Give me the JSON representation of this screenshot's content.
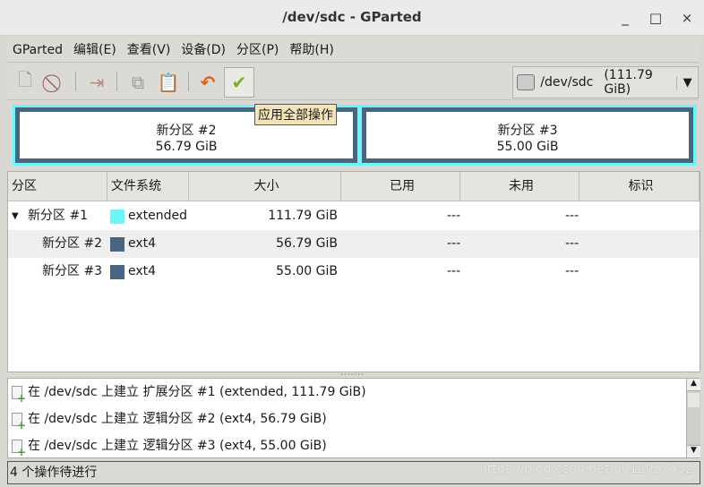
{
  "window": {
    "title": "/dev/sdc - GParted",
    "minimize": "_",
    "maximize": "□",
    "close": "×"
  },
  "menu": [
    "GParted",
    "编辑(E)",
    "查看(V)",
    "设备(D)",
    "分区(P)",
    "帮助(H)"
  ],
  "toolbar": {
    "tooltip": "应用全部操作"
  },
  "device": {
    "name": "/dev/sdc",
    "size": "(111.79 GiB)"
  },
  "graph": [
    {
      "name": "新分区 #2",
      "size": "56.79 GiB"
    },
    {
      "name": "新分区 #3",
      "size": "55.00 GiB"
    }
  ],
  "colors": {
    "extended": "#6ff5f5",
    "ext4": "#4a6580"
  },
  "table": {
    "headers": [
      "分区",
      "文件系统",
      "大小",
      "已用",
      "未用",
      "标识"
    ],
    "rows": [
      {
        "partition": "新分区 #1",
        "fs": "extended",
        "size": "111.79 GiB",
        "used": "---",
        "unused": "---",
        "flags": ""
      },
      {
        "partition": "新分区 #2",
        "fs": "ext4",
        "size": "56.79 GiB",
        "used": "---",
        "unused": "---",
        "flags": ""
      },
      {
        "partition": "新分区 #3",
        "fs": "ext4",
        "size": "55.00 GiB",
        "used": "---",
        "unused": "---",
        "flags": ""
      }
    ]
  },
  "log": [
    "在 /dev/sdc 上建立 扩展分区 #1 (extended, 111.79 GiB)",
    "在 /dev/sdc 上建立 逻辑分区 #2 (ext4, 56.79 GiB)",
    "在 /dev/sdc 上建立 逻辑分区 #3 (ext4, 55.00 GiB)"
  ],
  "status": "4 个操作待进行",
  "watermark": "https://blog.csdn.net/u012057432"
}
